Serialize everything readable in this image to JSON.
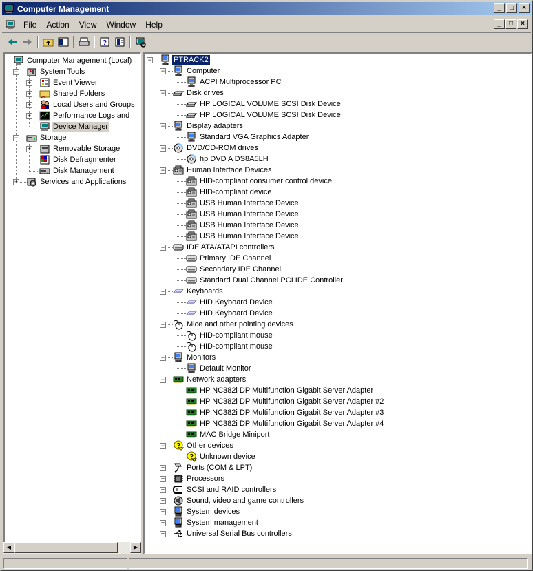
{
  "window": {
    "title": "Computer Management",
    "title_buttons": [
      "_",
      "□",
      "×"
    ],
    "accent": "#0a246a"
  },
  "menu": [
    "File",
    "Action",
    "View",
    "Window",
    "Help"
  ],
  "toolbar": [
    "back-arrow-icon",
    "forward-arrow-icon",
    "up-folder-icon",
    "show-hide-tree-icon",
    "print-icon",
    "help-icon",
    "properties-icon",
    "scan-hardware-icon"
  ],
  "left_tree": [
    {
      "label": "Computer Management (Local)",
      "icon": "computer-management-icon",
      "expander": "",
      "level": 0
    },
    {
      "label": "System Tools",
      "icon": "system-tools-icon",
      "expander": "−",
      "level": 1
    },
    {
      "label": "Event Viewer",
      "icon": "event-viewer-icon",
      "expander": "+",
      "level": 2
    },
    {
      "label": "Shared Folders",
      "icon": "shared-folders-icon",
      "expander": "+",
      "level": 2
    },
    {
      "label": "Local Users and Groups",
      "icon": "users-icon",
      "expander": "+",
      "level": 2
    },
    {
      "label": "Performance Logs and Alerts",
      "icon": "performance-icon",
      "expander": "+",
      "level": 2
    },
    {
      "label": "Device Manager",
      "icon": "device-manager-icon",
      "expander": "",
      "level": 2,
      "selected": true
    },
    {
      "label": "Storage",
      "icon": "storage-icon",
      "expander": "−",
      "level": 1
    },
    {
      "label": "Removable Storage",
      "icon": "removable-storage-icon",
      "expander": "+",
      "level": 2
    },
    {
      "label": "Disk Defragmenter",
      "icon": "defrag-icon",
      "expander": "",
      "level": 2
    },
    {
      "label": "Disk Management",
      "icon": "disk-management-icon",
      "expander": "",
      "level": 2
    },
    {
      "label": "Services and Applications",
      "icon": "services-icon",
      "expander": "+",
      "level": 1
    }
  ],
  "device_tree": [
    {
      "label": "PTRACK2",
      "icon": "computer-icon",
      "expander": "−",
      "level": 0,
      "selected": true
    },
    {
      "label": "Computer",
      "icon": "computer-icon",
      "expander": "−",
      "level": 1
    },
    {
      "label": "ACPI Multiprocessor PC",
      "icon": "computer-icon",
      "expander": "",
      "level": 2
    },
    {
      "label": "Disk drives",
      "icon": "disk-drive-icon",
      "expander": "−",
      "level": 1
    },
    {
      "label": "HP LOGICAL VOLUME SCSI Disk Device",
      "icon": "disk-drive-icon",
      "expander": "",
      "level": 2
    },
    {
      "label": "HP LOGICAL VOLUME SCSI Disk Device",
      "icon": "disk-drive-icon",
      "expander": "",
      "level": 2
    },
    {
      "label": "Display adapters",
      "icon": "monitor-icon",
      "expander": "−",
      "level": 1
    },
    {
      "label": "Standard VGA Graphics Adapter",
      "icon": "monitor-icon",
      "expander": "",
      "level": 2
    },
    {
      "label": "DVD/CD-ROM drives",
      "icon": "cdrom-icon",
      "expander": "−",
      "level": 1
    },
    {
      "label": "hp DVD A  DS8A5LH",
      "icon": "cdrom-icon",
      "expander": "",
      "level": 2
    },
    {
      "label": "Human Interface Devices",
      "icon": "hid-icon",
      "expander": "−",
      "level": 1
    },
    {
      "label": "HID-compliant consumer control device",
      "icon": "hid-icon",
      "expander": "",
      "level": 2
    },
    {
      "label": "HID-compliant device",
      "icon": "hid-icon",
      "expander": "",
      "level": 2
    },
    {
      "label": "USB Human Interface Device",
      "icon": "hid-icon",
      "expander": "",
      "level": 2
    },
    {
      "label": "USB Human Interface Device",
      "icon": "hid-icon",
      "expander": "",
      "level": 2
    },
    {
      "label": "USB Human Interface Device",
      "icon": "hid-icon",
      "expander": "",
      "level": 2
    },
    {
      "label": "USB Human Interface Device",
      "icon": "hid-icon",
      "expander": "",
      "level": 2
    },
    {
      "label": "IDE ATA/ATAPI controllers",
      "icon": "ide-icon",
      "expander": "−",
      "level": 1
    },
    {
      "label": "Primary IDE Channel",
      "icon": "ide-icon",
      "expander": "",
      "level": 2
    },
    {
      "label": "Secondary IDE Channel",
      "icon": "ide-icon",
      "expander": "",
      "level": 2
    },
    {
      "label": "Standard Dual Channel PCI IDE Controller",
      "icon": "ide-icon",
      "expander": "",
      "level": 2
    },
    {
      "label": "Keyboards",
      "icon": "keyboard-icon",
      "expander": "−",
      "level": 1
    },
    {
      "label": "HID Keyboard Device",
      "icon": "keyboard-icon",
      "expander": "",
      "level": 2
    },
    {
      "label": "HID Keyboard Device",
      "icon": "keyboard-icon",
      "expander": "",
      "level": 2
    },
    {
      "label": "Mice and other pointing devices",
      "icon": "mouse-icon",
      "expander": "−",
      "level": 1
    },
    {
      "label": "HID-compliant mouse",
      "icon": "mouse-icon",
      "expander": "",
      "level": 2
    },
    {
      "label": "HID-compliant mouse",
      "icon": "mouse-icon",
      "expander": "",
      "level": 2
    },
    {
      "label": "Monitors",
      "icon": "monitor-icon",
      "expander": "−",
      "level": 1
    },
    {
      "label": "Default Monitor",
      "icon": "monitor-icon",
      "expander": "",
      "level": 2
    },
    {
      "label": "Network adapters",
      "icon": "network-adapter-icon",
      "expander": "−",
      "level": 1
    },
    {
      "label": "HP NC382i DP Multifunction Gigabit Server Adapter",
      "icon": "network-adapter-icon",
      "expander": "",
      "level": 2
    },
    {
      "label": "HP NC382i DP Multifunction Gigabit Server Adapter #2",
      "icon": "network-adapter-icon",
      "expander": "",
      "level": 2
    },
    {
      "label": "HP NC382i DP Multifunction Gigabit Server Adapter #3",
      "icon": "network-adapter-icon",
      "expander": "",
      "level": 2
    },
    {
      "label": "HP NC382i DP Multifunction Gigabit Server Adapter #4",
      "icon": "network-adapter-icon",
      "expander": "",
      "level": 2
    },
    {
      "label": "MAC Bridge Miniport",
      "icon": "network-adapter-icon",
      "expander": "",
      "level": 2
    },
    {
      "label": "Other devices",
      "icon": "unknown-device-icon",
      "expander": "−",
      "level": 1
    },
    {
      "label": "Unknown device",
      "icon": "unknown-device-icon",
      "expander": "",
      "level": 2
    },
    {
      "label": "Ports (COM & LPT)",
      "icon": "port-icon",
      "expander": "+",
      "level": 1
    },
    {
      "label": "Processors",
      "icon": "processor-icon",
      "expander": "+",
      "level": 1
    },
    {
      "label": "SCSI and RAID controllers",
      "icon": "scsi-icon",
      "expander": "+",
      "level": 1
    },
    {
      "label": "Sound, video and game controllers",
      "icon": "sound-icon",
      "expander": "+",
      "level": 1
    },
    {
      "label": "System devices",
      "icon": "system-device-icon",
      "expander": "+",
      "level": 1
    },
    {
      "label": "System management",
      "icon": "system-device-icon",
      "expander": "+",
      "level": 1
    },
    {
      "label": "Universal Serial Bus controllers",
      "icon": "usb-icon",
      "expander": "+",
      "level": 1
    }
  ]
}
